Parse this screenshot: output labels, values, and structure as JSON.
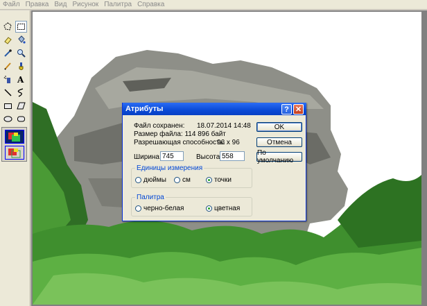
{
  "menu": [
    "Файл",
    "Правка",
    "Вид",
    "Рисунок",
    "Палитра",
    "Справка"
  ],
  "toolbox": {
    "tools": [
      "free-select-icon",
      "rect-select-icon",
      "eraser-icon",
      "fill-bucket-icon",
      "color-picker-icon",
      "magnifier-icon",
      "pencil-icon",
      "brush-icon",
      "airbrush-icon",
      "text-icon",
      "line-icon",
      "curve-icon",
      "rectangle-icon",
      "polygon-icon",
      "ellipse-icon",
      "rounded-rect-icon"
    ],
    "selected_tool": "rect-select-icon",
    "options": [
      "opaque-background-icon",
      "transparent-background-icon"
    ],
    "active_option": "opaque-background-icon"
  },
  "dialog": {
    "title": "Атрибуты",
    "help_label": "?",
    "close_label": "✕",
    "saved_label": "Файл сохранен:",
    "saved_value": "18.07.2014 14:48",
    "size_label": "Размер файла: 114 896 байт",
    "resolution_label": "Разрешающая способность:",
    "resolution_value": "96 x 96",
    "width_label": "Ширина:",
    "width_value": "745",
    "height_label": "Высота:",
    "height_value": "558",
    "units_legend": "Единицы измерения",
    "units": {
      "options": [
        "дюймы",
        "см",
        "точки"
      ],
      "selected": "точки"
    },
    "palette_legend": "Палитра",
    "palette": {
      "options": [
        "черно-белая",
        "цветная"
      ],
      "selected": "цветная"
    },
    "ok_label": "OK",
    "cancel_label": "Отмена",
    "default_label": "По умолчанию"
  },
  "colors": {
    "titlebar": "#0a4ad6",
    "dialog_bg": "#ece9d8",
    "workspace": "#808080",
    "canvas": "#ffffff",
    "rock": "#8e8f88",
    "foliage": "#3f8f2e"
  }
}
